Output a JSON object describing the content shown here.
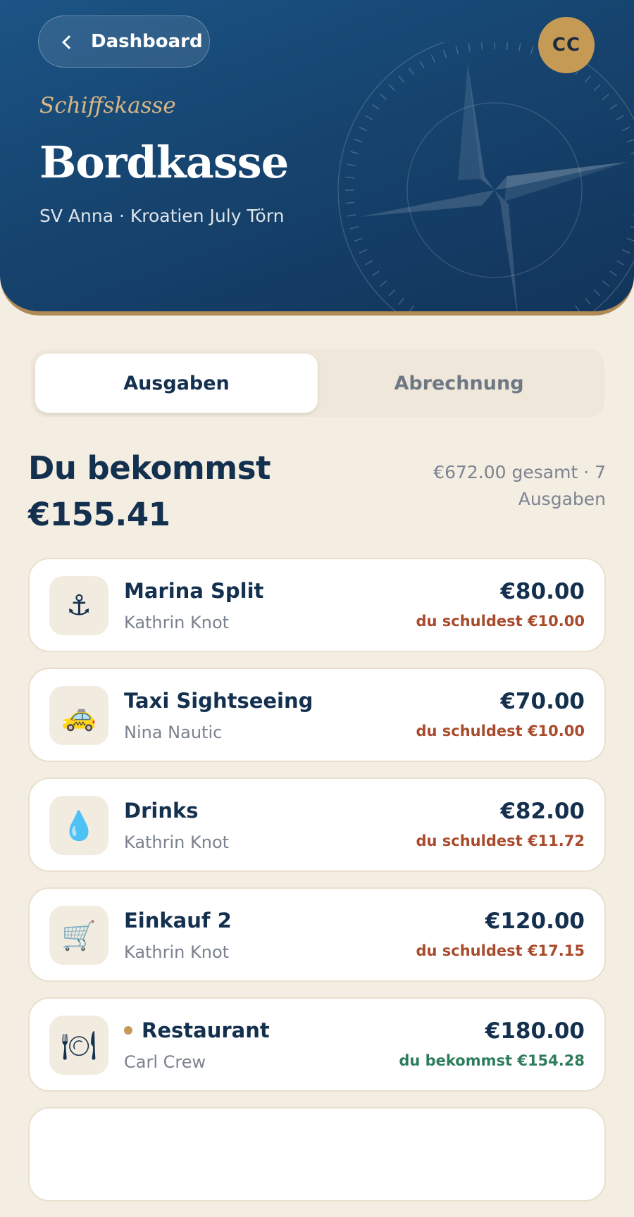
{
  "header": {
    "back_label": "Dashboard",
    "avatar_initials": "CC",
    "eyebrow": "Schiffskasse",
    "title": "Bordkasse",
    "subtitle": "SV Anna · Kroatien July Törn",
    "colors": {
      "background": "#16446f",
      "accent": "#b08a55",
      "avatar": "#c59a55"
    }
  },
  "tabs": [
    {
      "label": "Ausgaben",
      "active": true
    },
    {
      "label": "Abrechnung",
      "active": false
    }
  ],
  "summary": {
    "title_line1": "Du bekommst",
    "title_line2": "€155.41",
    "side_line1": "€672.00 gesamt · 7",
    "side_line2": "Ausgaben"
  },
  "expenses": [
    {
      "icon": "anchor-icon",
      "glyph": "⚓",
      "name": "Marina Split",
      "payer": "Kathrin Knot",
      "amount": "€80.00",
      "share": "du schuldest €10.00",
      "share_type": "owe",
      "dot": false
    },
    {
      "icon": "taxi-icon",
      "glyph": "🚕",
      "name": "Taxi Sightseeing",
      "payer": "Nina Nautic",
      "amount": "€70.00",
      "share": "du schuldest €10.00",
      "share_type": "owe",
      "dot": false
    },
    {
      "icon": "droplet-icon",
      "glyph": "💧",
      "name": "Drinks",
      "payer": "Kathrin Knot",
      "amount": "€82.00",
      "share": "du schuldest €11.72",
      "share_type": "owe",
      "dot": false
    },
    {
      "icon": "shopping-cart-icon",
      "glyph": "🛒",
      "name": "Einkauf 2",
      "payer": "Kathrin Knot",
      "amount": "€120.00",
      "share": "du schuldest €17.15",
      "share_type": "owe",
      "dot": false
    },
    {
      "icon": "plate-cutlery-icon",
      "glyph": "🍽",
      "name": "Restaurant",
      "payer": "Carl Crew",
      "amount": "€180.00",
      "share": "du bekommst €154.28",
      "share_type": "get",
      "dot": true
    }
  ]
}
